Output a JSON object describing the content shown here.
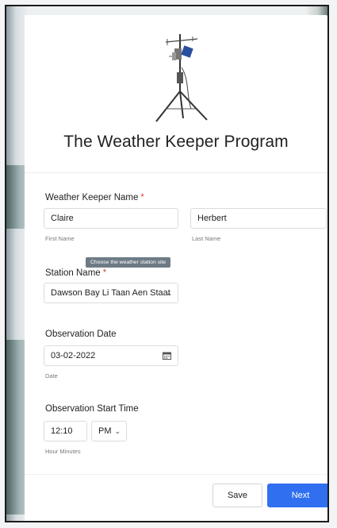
{
  "page": {
    "title": "The Weather Keeper Program"
  },
  "form": {
    "keeper_name": {
      "label": "Weather Keeper Name",
      "required_mark": "*",
      "first_value": "Claire",
      "first_hint": "First Name",
      "last_value": "Herbert",
      "last_hint": "Last Name"
    },
    "station": {
      "tooltip": "Choose the weather station site",
      "label": "Station Name",
      "required_mark": "*",
      "selected_value": "Dawson Bay Li Taan Aen Staat"
    },
    "date": {
      "label": "Observation Date",
      "value": "03-02-2022",
      "hint": "Date",
      "icon": "calendar-icon"
    },
    "time": {
      "label": "Observation Start Time",
      "value": "12:10",
      "ampm": "PM",
      "hint": "Hour Minutes"
    }
  },
  "actions": {
    "save_label": "Save",
    "next_label": "Next"
  },
  "colors": {
    "accent": "#2f6ff0",
    "required": "#e0463c",
    "tooltip_bg": "#6e7b86"
  }
}
